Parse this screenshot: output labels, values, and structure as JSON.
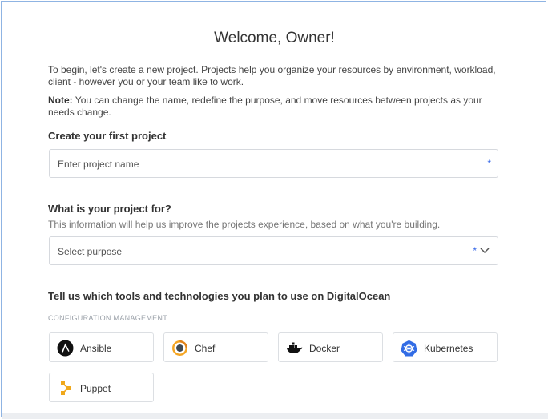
{
  "header": {
    "title": "Welcome, Owner!"
  },
  "intro": {
    "text": "To begin, let's create a new project. Projects help you organize your resources by environment, workload, client - however you or your team like to work.",
    "note_label": "Note:",
    "note_text": " You can change the name, redefine the purpose, and move resources between projects as your needs change."
  },
  "project": {
    "heading": "Create your first project",
    "name_placeholder": "Enter project name",
    "required_mark": "*"
  },
  "purpose": {
    "heading": "What is your project for?",
    "help": "This information will help us improve the projects experience, based on what you're building.",
    "select_value": "Select purpose",
    "required_mark": "*"
  },
  "tools": {
    "heading": "Tell us which tools and technologies you plan to use on DigitalOcean",
    "category": "CONFIGURATION MANAGEMENT",
    "items": [
      {
        "label": "Ansible",
        "icon": "ansible-icon"
      },
      {
        "label": "Chef",
        "icon": "chef-icon"
      },
      {
        "label": "Docker",
        "icon": "docker-icon"
      },
      {
        "label": "Kubernetes",
        "icon": "kubernetes-icon"
      },
      {
        "label": "Puppet",
        "icon": "puppet-icon"
      }
    ]
  },
  "colors": {
    "accent": "#3567e8",
    "border": "#d6d9de",
    "frame": "#8fb4e3"
  }
}
